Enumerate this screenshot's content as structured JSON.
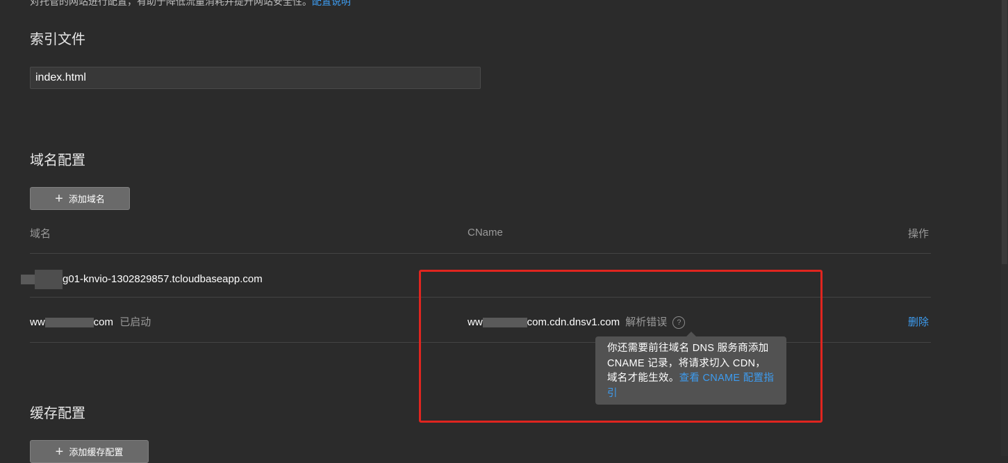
{
  "intro": {
    "text": "对托管的网站进行配置，有助于降低流量消耗并提升网站安全性。",
    "link": "配置说明"
  },
  "index_section": {
    "title": "索引文件",
    "input_value": "index.html"
  },
  "domain_section": {
    "title": "域名配置",
    "add_button": "添加域名",
    "columns": {
      "domain": "域名",
      "cname": "CName",
      "actions": "操作"
    },
    "rows": [
      {
        "domain_suffix": "g01-knvio-1302829857.tcloudbaseapp.com"
      },
      {
        "domain_prefix": "ww",
        "domain_suffix": "com",
        "status": "已启动",
        "cname_prefix": "ww",
        "cname_suffix": "com.cdn.dnsv1.com",
        "cname_status": "解析错误",
        "action": "删除"
      }
    ],
    "tooltip": {
      "text": "你还需要前往域名 DNS 服务商添加 CNAME 记录，将请求切入 CDN，域名才能生效。",
      "link": "查看 CNAME 配置指引"
    }
  },
  "cache_section": {
    "title": "缓存配置",
    "add_button": "添加缓存配置"
  },
  "colors": {
    "background": "#2b2b2b",
    "accent_link": "#3d9cf0",
    "highlight_box": "#e0251f",
    "tooltip_bg": "#525252"
  }
}
